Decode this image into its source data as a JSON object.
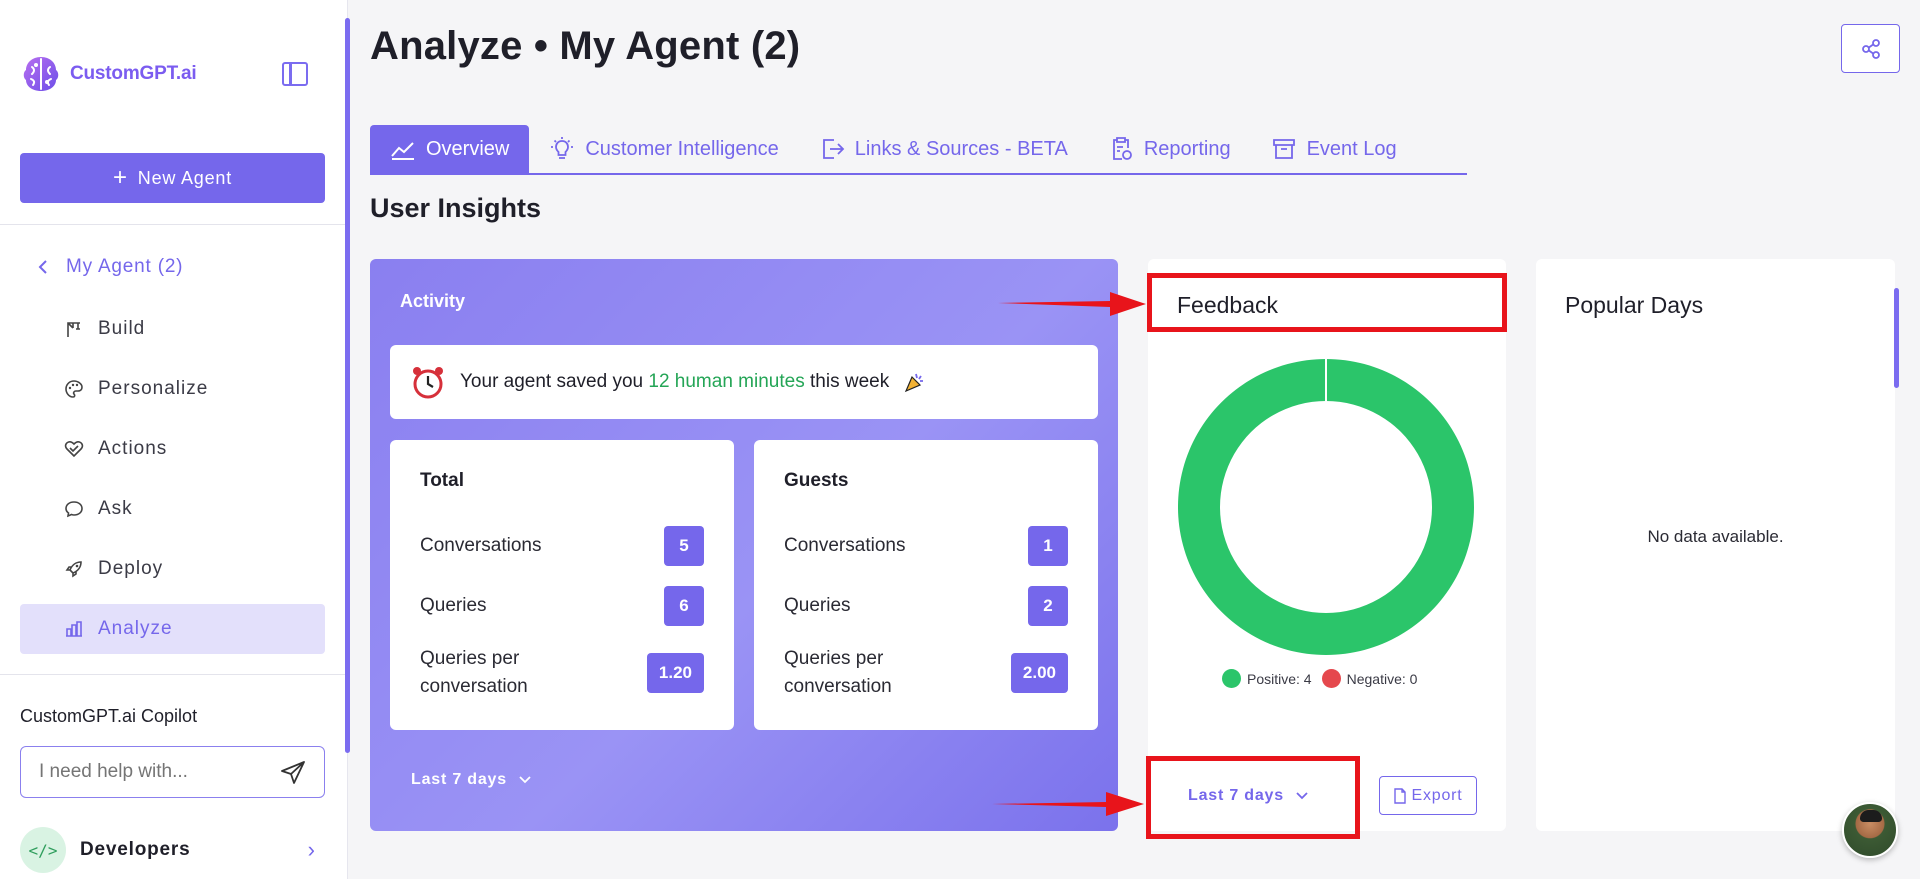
{
  "brand": {
    "name": "CustomGPT.ai"
  },
  "sidebar": {
    "new_agent_label": "New Agent",
    "back_label": "My Agent (2)",
    "items": [
      {
        "label": "Build",
        "icon": "crane-icon"
      },
      {
        "label": "Personalize",
        "icon": "palette-icon"
      },
      {
        "label": "Actions",
        "icon": "heart-handshake-icon"
      },
      {
        "label": "Ask",
        "icon": "chat-bubble-icon"
      },
      {
        "label": "Deploy",
        "icon": "rocket-icon"
      },
      {
        "label": "Analyze",
        "icon": "bar-chart-icon",
        "active": true
      }
    ],
    "copilot": {
      "title": "CustomGPT.ai Copilot",
      "placeholder": "I need help with..."
    },
    "developers_label": "Developers"
  },
  "header": {
    "title": "Analyze • My Agent (2)"
  },
  "tabs": [
    {
      "label": "Overview",
      "active": true,
      "icon": "trend-line-icon"
    },
    {
      "label": "Customer Intelligence",
      "icon": "lightbulb-icon"
    },
    {
      "label": "Links & Sources - BETA",
      "icon": "export-icon"
    },
    {
      "label": "Reporting",
      "icon": "clipboard-icon"
    },
    {
      "label": "Event Log",
      "icon": "archive-icon"
    }
  ],
  "section_title": "User Insights",
  "activity": {
    "title": "Activity",
    "saved_prefix": "Your agent saved you",
    "saved_highlight": "12 human minutes",
    "saved_suffix": "this week",
    "total": {
      "title": "Total",
      "rows": [
        {
          "label": "Conversations",
          "value": "5"
        },
        {
          "label": "Queries",
          "value": "6"
        },
        {
          "label": "Queries per conversation",
          "value": "1.20"
        }
      ]
    },
    "guests": {
      "title": "Guests",
      "rows": [
        {
          "label": "Conversations",
          "value": "1"
        },
        {
          "label": "Queries",
          "value": "2"
        },
        {
          "label": "Queries per conversation",
          "value": "2.00"
        }
      ]
    },
    "filter_label": "Last 7 days"
  },
  "feedback": {
    "title": "Feedback",
    "legend_positive": "Positive: 4",
    "legend_negative": "Negative: 0",
    "filter_label": "Last 7 days",
    "export_label": "Export"
  },
  "chart_data": {
    "type": "pie",
    "categories": [
      "Positive",
      "Negative"
    ],
    "values": [
      4,
      0
    ],
    "colors": [
      "#2bc56a",
      "#e5484d"
    ],
    "title": "Feedback"
  },
  "popular_days": {
    "title": "Popular Days",
    "empty_text": "No data available."
  },
  "colors": {
    "accent": "#7567eb",
    "positive": "#2bc56a",
    "negative": "#e5484d",
    "annotation": "#e8141b"
  }
}
